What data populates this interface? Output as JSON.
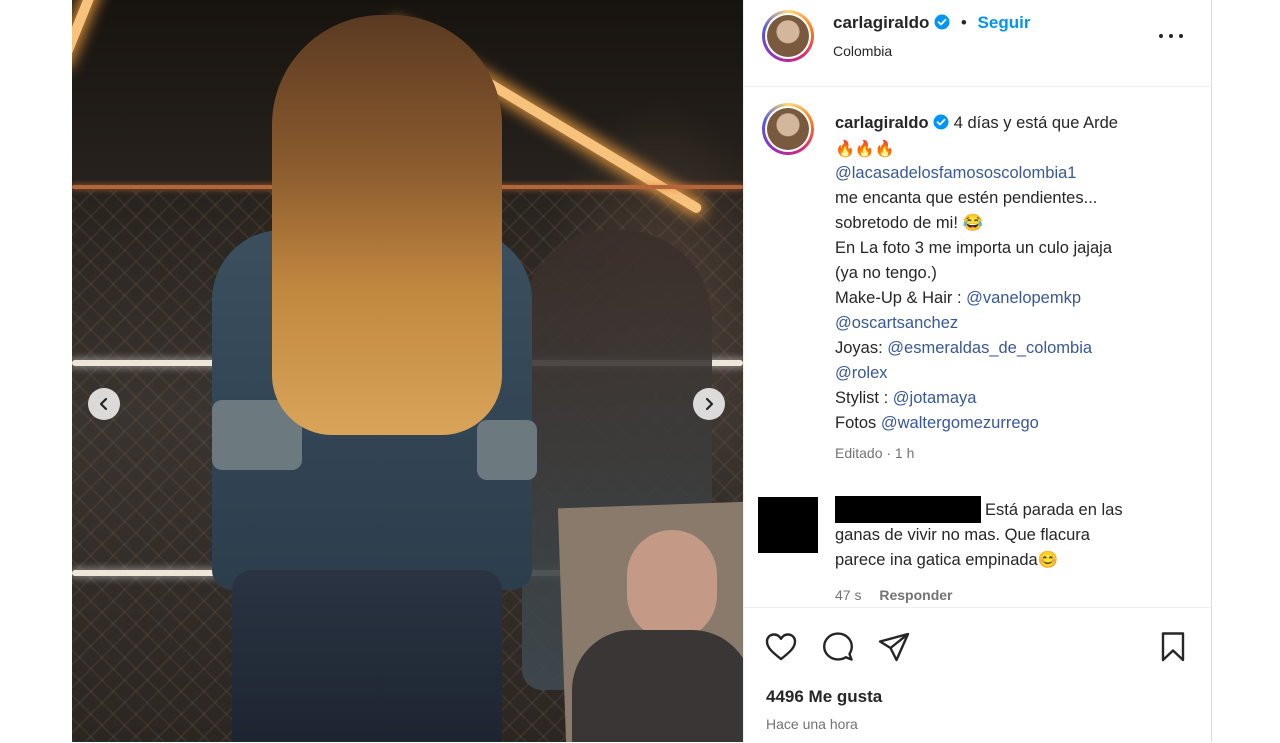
{
  "post": {
    "header": {
      "username": "carlagiraldo",
      "separator": "•",
      "follow_label": "Seguir",
      "location": "Colombia",
      "verified_icon": "verified-badge-icon",
      "more_icon": "more-options-icon"
    },
    "media": {
      "prev_icon": "chevron-left-icon",
      "next_icon": "chevron-right-icon"
    },
    "caption": {
      "username": "carlagiraldo",
      "intro": "4 días y está que Arde",
      "fire_emojis": "🔥🔥🔥",
      "mention_house": "@lacasadelosfamososcolombia1",
      "line_pendientes": "me encanta que estén pendientes...",
      "line_sobretodo": "sobretodo de mi! 😂",
      "line_foto3": "En La foto 3 me importa un culo jajaja",
      "line_yano": "(ya no tengo.)",
      "makeup_label": "Make-Up & Hair :",
      "makeup_mention": "@vanelopemkp",
      "mention_oscar": "@oscartsanchez",
      "joyas_label": "Joyas:",
      "joyas_mention": "@esmeraldas_de_colombia",
      "mention_rolex": "@rolex",
      "stylist_label": "Stylist :",
      "stylist_mention": "@jotamaya",
      "fotos_label": "Fotos",
      "fotos_mention": "@waltergomezurrego",
      "meta": "Editado · 1 h"
    },
    "comment": {
      "line1": "Está parada en las",
      "line2": "ganas de vivir no mas. Que flacura",
      "line3": "parece ina gatica empinada😊",
      "time": "47 s",
      "reply_label": "Responder"
    },
    "actions": {
      "like_icon": "heart-icon",
      "comment_icon": "comment-icon",
      "share_icon": "share-icon",
      "save_icon": "bookmark-icon",
      "likes_text": "4496 Me gusta",
      "posted": "Hace una hora"
    },
    "colors": {
      "accent_blue": "#0095f6",
      "mention_blue": "#385898",
      "muted_text": "#737373"
    }
  }
}
